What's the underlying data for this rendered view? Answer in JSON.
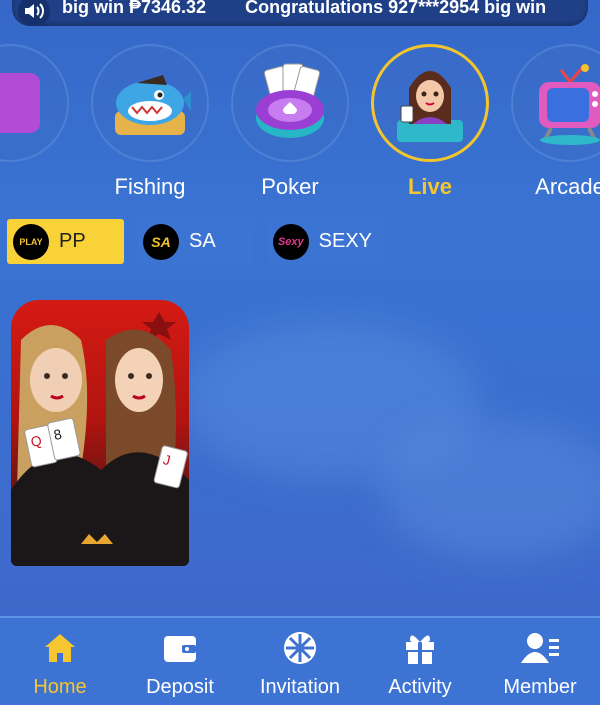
{
  "marquee": {
    "messages": [
      "big win ₱7346.32",
      "Congratulations 927***2954 big win"
    ]
  },
  "categories": [
    {
      "label": "Fishing",
      "icon": "shark-icon"
    },
    {
      "label": "Poker",
      "icon": "poker-chip-icon"
    },
    {
      "label": "Live",
      "icon": "live-dealer-icon",
      "active": true
    },
    {
      "label": "Arcade",
      "icon": "arcade-tv-icon"
    }
  ],
  "providers": [
    {
      "label": "PP",
      "logo_text": "PLAY",
      "active": true
    },
    {
      "label": "SA",
      "logo_text": "SA"
    },
    {
      "label": "SEXY",
      "logo_text": "Sexy"
    }
  ],
  "tabs": [
    {
      "label": "Home",
      "icon": "home-icon",
      "active": true
    },
    {
      "label": "Deposit",
      "icon": "wallet-icon"
    },
    {
      "label": "Invitation",
      "icon": "wheel-icon"
    },
    {
      "label": "Activity",
      "icon": "gift-icon"
    },
    {
      "label": "Member",
      "icon": "member-icon"
    }
  ],
  "colors": {
    "accent": "#f5c630",
    "tabbar": "#3d73d3",
    "provider_active": "#f8d237"
  }
}
